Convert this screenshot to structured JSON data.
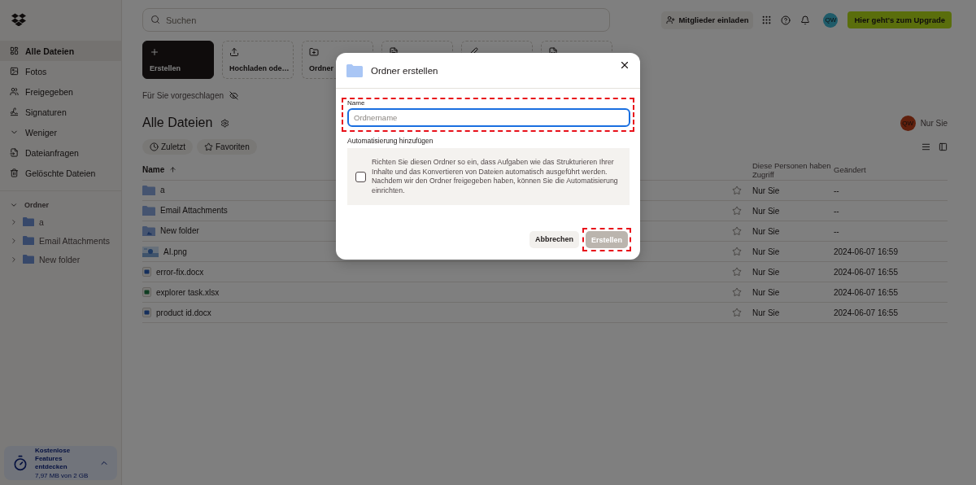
{
  "sidebar": {
    "items": [
      {
        "label": "Alle Dateien",
        "kind": "all",
        "selected": true
      },
      {
        "label": "Fotos",
        "kind": "photos",
        "selected": false
      },
      {
        "label": "Freigegeben",
        "kind": "shared",
        "selected": false
      },
      {
        "label": "Signaturen",
        "kind": "signatures",
        "selected": false
      },
      {
        "label": "Weniger",
        "kind": "less",
        "selected": false
      },
      {
        "label": "Dateianfragen",
        "kind": "requests",
        "selected": false
      },
      {
        "label": "Gelöschte Dateien",
        "kind": "deleted",
        "selected": false
      }
    ],
    "folders_heading": "Ordner",
    "folders": [
      {
        "label": "a",
        "expanded": false
      },
      {
        "label": "Email Attachments",
        "expanded": false
      },
      {
        "label": "New folder",
        "expanded": false
      }
    ],
    "promo": {
      "title": "Kostenlose Features entdecken",
      "usage": "7,97 MB von 2 GB"
    }
  },
  "topbar": {
    "search_placeholder": "Suchen",
    "invite": "Mitglieder einladen",
    "avatar": "QW",
    "upgrade": "Hier geht's zum Upgrade"
  },
  "actions": [
    {
      "label": "Erstellen",
      "kind": "create"
    },
    {
      "label": "Hochladen ode…",
      "kind": "upload"
    },
    {
      "label": "Ordner",
      "kind": "folder"
    },
    {
      "kind": "file"
    },
    {
      "kind": "sign"
    },
    {
      "kind": "doc"
    }
  ],
  "suggested": "Für Sie vorgeschlagen",
  "heading": "Alle Dateien",
  "sharing": {
    "avatar": "QW",
    "label": "Nur Sie"
  },
  "filters": [
    {
      "label": "Zuletzt",
      "kind": "recent"
    },
    {
      "label": "Favoriten",
      "kind": "favorites"
    }
  ],
  "table": {
    "columns": [
      "Name",
      "Diese Personen haben Zugriff",
      "Geändert"
    ],
    "rows": [
      {
        "name": "a",
        "kind": "folder",
        "starred": false,
        "access": "Nur Sie",
        "changed": "--"
      },
      {
        "name": "Email Attachments",
        "kind": "folder",
        "starred": false,
        "access": "Nur Sie",
        "changed": "--"
      },
      {
        "name": "New folder",
        "kind": "shared-folder",
        "starred": false,
        "access": "Nur Sie",
        "changed": "--"
      },
      {
        "name": "AI.png",
        "starred": false,
        "access": "Nur Sie",
        "changed": "2024-06-07 16:59"
      },
      {
        "name": "error-fix.docx",
        "kind": "docx",
        "starred": false,
        "access": "Nur Sie",
        "changed": "2024-06-07 16:55"
      },
      {
        "name": "explorer task.xlsx",
        "kind": "xlsx",
        "starred": false,
        "access": "Nur Sie",
        "changed": "2024-06-07 16:55"
      },
      {
        "name": "product id.docx",
        "kind": "docx",
        "starred": false,
        "access": "Nur Sie",
        "changed": "2024-06-07 16:55"
      }
    ]
  },
  "dialog": {
    "title": "Ordner erstellen",
    "field_label": "Name",
    "placeholder": "Ordnername",
    "section_label": "Automatisierung hinzufügen",
    "automation_text": "Richten Sie diesen Ordner so ein, dass Aufgaben wie das Strukturieren Ihrer Inhalte und das Konvertieren von Dateien automatisch ausgeführt werden. Nachdem wir den Ordner freigegeben haben, können Sie die Automatisierung einrichten.",
    "automation_checked": false,
    "cancel": "Abbrechen",
    "submit": {
      "label": "Erstellen",
      "disabled": true
    }
  }
}
